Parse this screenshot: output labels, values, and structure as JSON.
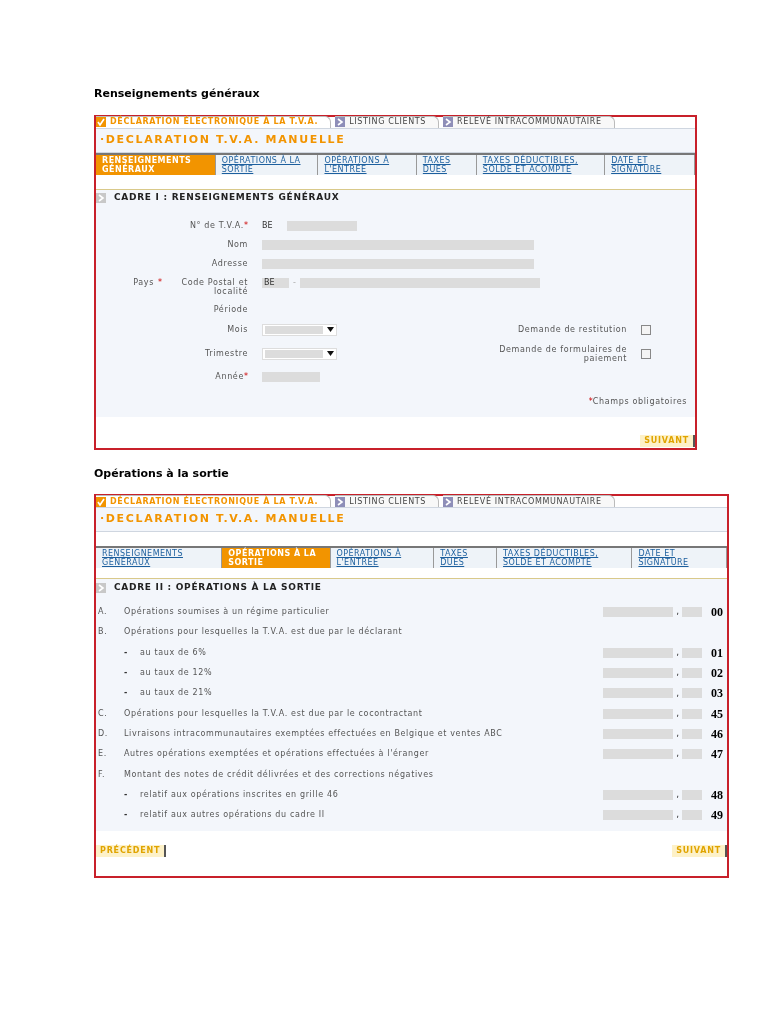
{
  "page1": {
    "heading": "Renseignements généraux",
    "top_tabs": [
      {
        "label": "DÉCLARATION ÉLECTRONIQUE À LA T.V.A.",
        "selected": true
      },
      {
        "label": "LISTING CLIENTS",
        "selected": false
      },
      {
        "label": "RELEVÉ INTRACOMMUNAUTAIRE",
        "selected": false
      }
    ],
    "title": "·DECLARATION T.V.A. MANUELLE",
    "steps": [
      {
        "label": "RENSEIGNEMENTS GÉNÉRAUX",
        "selected": true
      },
      {
        "label": "OPÉRATIONS À LA SORTIE",
        "selected": false
      },
      {
        "label": "OPÉRATIONS À L'ENTRÉE",
        "selected": false
      },
      {
        "label": "TAXES DUES",
        "selected": false
      },
      {
        "label": "TAXES DÉDUCTIBLES, SOLDE ET ACOMPTE",
        "selected": false
      },
      {
        "label": "DATE ET SIGNATURE",
        "selected": false
      }
    ],
    "cadre_title": "CADRE I : RENSEIGNEMENTS GÉNÉRAUX",
    "vat": {
      "label": "N° de T.V.A.",
      "mark": "*",
      "prefix": "BE"
    },
    "nom": {
      "label": "Nom"
    },
    "adresse": {
      "label": "Adresse"
    },
    "pays": {
      "label": "Pays",
      "mark": "*",
      "label2": "Code Postal et localité",
      "value": "BE",
      "separator": "-"
    },
    "periode": {
      "label": "Période"
    },
    "mois": {
      "label": "Mois",
      "check_label": "Demande de restitution",
      "checked": false
    },
    "trimestre": {
      "label": "Trimestre",
      "check_label": "Demande de formulaires de paiement",
      "checked": false
    },
    "annee": {
      "label": "Année",
      "mark": "*"
    },
    "note": {
      "mark": "*",
      "text": "Champs obligatoires"
    },
    "next": "SUIVANT"
  },
  "page2": {
    "heading": "Opérations à la sortie",
    "top_tabs": [
      {
        "label": "DÉCLARATION ÉLECTRONIQUE À LA T.V.A.",
        "selected": true
      },
      {
        "label": "LISTING CLIENTS",
        "selected": false
      },
      {
        "label": "RELEVÉ INTRACOMMUNAUTAIRE",
        "selected": false
      }
    ],
    "title": "·DECLARATION T.V.A. MANUELLE",
    "steps": [
      {
        "label": "RENSEIGNEMENTS GÉNÉRAUX",
        "selected": false
      },
      {
        "label": "OPÉRATIONS À LA SORTIE",
        "selected": true
      },
      {
        "label": "OPÉRATIONS À L'ENTRÉE",
        "selected": false
      },
      {
        "label": "TAXES DUES",
        "selected": false
      },
      {
        "label": "TAXES DÉDUCTIBLES, SOLDE ET ACOMPTE",
        "selected": false
      },
      {
        "label": "DATE ET SIGNATURE",
        "selected": false
      }
    ],
    "cadre_title": "CADRE II : OPÉRATIONS À LA SORTIE",
    "rows": [
      {
        "kind": "line",
        "letter": "A.",
        "label": "Opérations soumises à un régime particulier",
        "separator": ",",
        "code": "00"
      },
      {
        "kind": "heading",
        "letter": "B.",
        "label": "Opérations pour lesquelles la T.V.A. est due par le déclarant"
      },
      {
        "kind": "sub",
        "bullet": "-",
        "label": "au taux de 6%",
        "separator": ",",
        "code": "01"
      },
      {
        "kind": "sub",
        "bullet": "-",
        "label": "au taux de 12%",
        "separator": ",",
        "code": "02"
      },
      {
        "kind": "sub",
        "bullet": "-",
        "label": "au taux de 21%",
        "separator": ",",
        "code": "03"
      },
      {
        "kind": "line",
        "letter": "C.",
        "label": "Opérations pour lesquelles la T.V.A. est due par le cocontractant",
        "separator": ",",
        "code": "45"
      },
      {
        "kind": "line",
        "letter": "D.",
        "label": "Livraisons intracommunautaires exemptées effectuées en Belgique et ventes ABC",
        "separator": ",",
        "code": "46"
      },
      {
        "kind": "line",
        "letter": "E.",
        "label": "Autres opérations exemptées et opérations effectuées à l'éranger",
        "separator": ",",
        "code": "47"
      },
      {
        "kind": "heading",
        "letter": "F.",
        "label": "Montant des notes de crédit délivrées et des corrections négatives"
      },
      {
        "kind": "sub",
        "bullet": "-",
        "label": "relatif aux opérations inscrites en grille 46",
        "separator": ",",
        "code": "48"
      },
      {
        "kind": "sub",
        "bullet": "-",
        "label": "relatif aux autres opérations du cadre II",
        "separator": ",",
        "code": "49"
      }
    ],
    "prev": "PRÉCÉDENT",
    "next": "SUIVANT"
  }
}
